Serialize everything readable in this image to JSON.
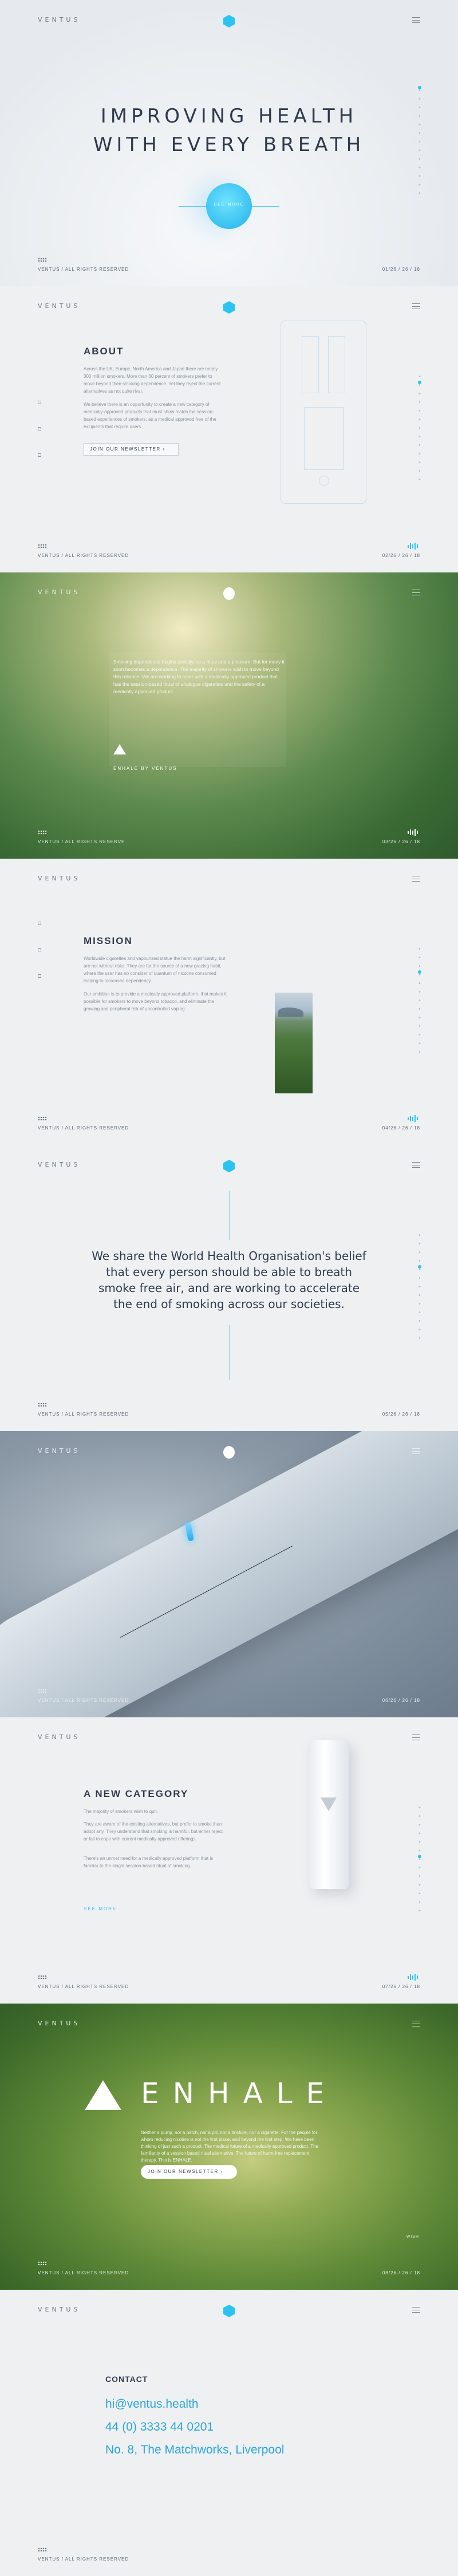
{
  "brand": {
    "name": "VENTUS",
    "accent": "#29c4f2"
  },
  "common": {
    "rights": "VENTUS / ALL RIGHTS RESERVED",
    "rights_short": "VENTUS / ALL RIGHTS RESERVE"
  },
  "s1": {
    "title_line1": "IMPROVING HEALTH",
    "title_line2": "WITH EVERY BREATH",
    "button": "SEE MORE",
    "page": "01/26 / 26 / 18"
  },
  "s2": {
    "heading": "ABOUT",
    "p1": "Across the UK, Europe, North America and Japan there are nearly 300 million smokers. More than 60 percent of smokers prefer to move beyond their smoking dependence. Yet they reject the current alternatives as not quite rival.",
    "p2": "We believe there is an opportunity to create a new category of medically-approved products that must show match the session-based experiences of smokers, as a medical approved free of the excipients that require users.",
    "button": "JOIN OUR NEWSLETTER",
    "page": "02/26 / 26 / 18"
  },
  "s3": {
    "text": "Smoking dependence begins socially, as a ritual and a pleasure. But for many it soon becomes a dependence. The majority of smokers wish to move beyond this reliance. We are working to cater with a medically approved product that has the session-based ritual of analogue cigarettes and the safety of a medically approved product.",
    "brand": "ENHALE BY VENTUS",
    "page": "03/26 / 26 / 18"
  },
  "s4": {
    "heading": "MISSION",
    "p1": "Worldwide cigarettes and vapourised statue the harm significantly, but are not without risks. They are far the source of a new grazing habit, where the user has no consider of quantum of nicotine consumed leading to increased dependency.",
    "p2": "Our ambition is to provide a medically approved platform, that makes it possible for smokers to move beyond tobacco, and eliminate the growing and peripheral risk of uncontrolled vaping.",
    "page": "04/26 / 26 / 18"
  },
  "s5": {
    "quote": "We share the World Health Organisation's belief that every person should be able to breath smoke free air, and are working to accelerate the end of smoking across our societies.",
    "page": "05/26 / 26 / 18"
  },
  "s6": {
    "page": "06/26 / 26 / 18"
  },
  "s7": {
    "heading": "A NEW CATEGORY",
    "p1": "The majority of smokers wish to quit.",
    "p2": "They are aware of the existing alternatives, but prefer to smoke than adopt any. They understand that smoking is harmful, but either reject or fail to cope with current medically approved offerings.",
    "p3": "There's an unmet need for a medically approved platform that is familiar to the single session-based ritual of smoking.",
    "link": "SEE MORE",
    "page": "07/26 / 26 / 18"
  },
  "s8": {
    "word": "ENHALE",
    "text": "Neither a pump, nor a patch, nor a pill, nor a tincture, nor a cigarette. For the people for whom reducing nicotine is not the first place, and beyond the first step. We have been thinking of just such a product. The medical future of a medically approved product. The familiarity of a session based ritual alternative. The future of harm-free replacement therapy. This is ENHALE.",
    "button": "JOIN OUR NEWSLETTER",
    "label": "WISH",
    "page": "08/26 / 26 / 18"
  },
  "s9": {
    "heading": "CONTACT",
    "email": "hi@ventus.health",
    "phone": "44 (0) 3333 44 0201",
    "address": "No. 8, The Matchworks, Liverpool"
  }
}
